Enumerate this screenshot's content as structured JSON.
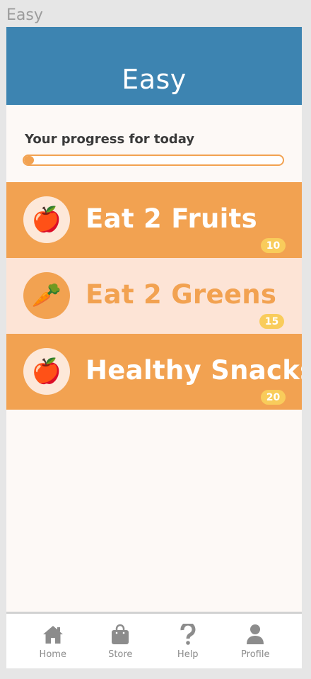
{
  "window": {
    "title": "Easy"
  },
  "header": {
    "title": "Easy"
  },
  "progress": {
    "label": "Your progress for today",
    "value": 0
  },
  "tasks": [
    {
      "title": "Eat 2 Fruits",
      "points": "10",
      "icon": "apple-icon",
      "emoji": "🍎",
      "style": "orange"
    },
    {
      "title": "Eat 2 Greens",
      "points": "15",
      "icon": "carrot-icon",
      "emoji": "🥕",
      "style": "light"
    },
    {
      "title": "Healthy Snacks",
      "points": "20",
      "icon": "apple-icon",
      "emoji": "🍎",
      "style": "orange"
    }
  ],
  "nav": [
    {
      "label": "Home",
      "icon": "home-icon"
    },
    {
      "label": "Store",
      "icon": "shopping-bag-icon"
    },
    {
      "label": "Help",
      "icon": "question-mark-icon"
    },
    {
      "label": "Profile",
      "icon": "user-icon"
    }
  ],
  "colors": {
    "header": "#3d84b1",
    "accent": "#f2a251",
    "light": "#fde4d6",
    "badge": "#f9cc5b"
  }
}
